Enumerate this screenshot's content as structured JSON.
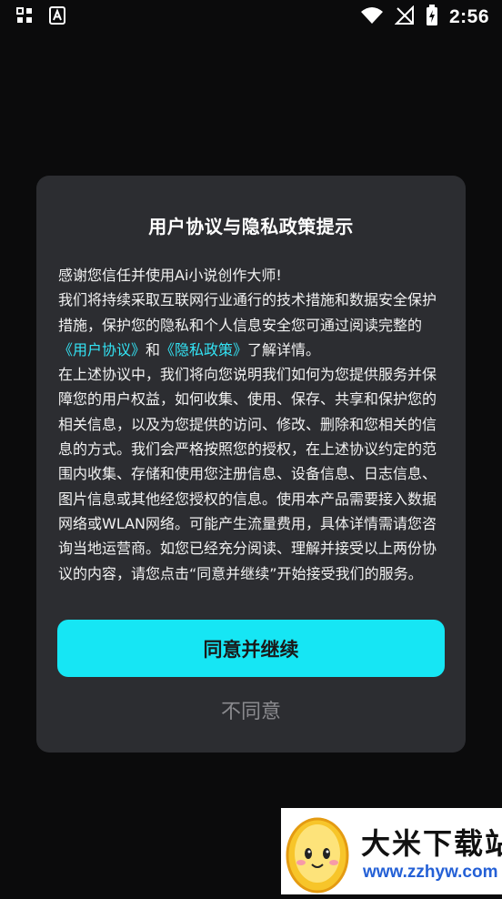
{
  "status_bar": {
    "time": "2:56"
  },
  "dialog": {
    "title": "用户协议与隐私政策提示",
    "intro": "感谢您信任并使用Ai小说创作大师!",
    "para1_start": "我们将持续采取互联网行业通行的技术措施和数据安全保护措施，保护您的隐私和个人信息安全您可通过阅读完整的",
    "user_agreement_link": "《用户协议》",
    "and_text": "和",
    "privacy_policy_link": "《隐私政策》",
    "para1_end": "了解详情。",
    "para2": "在上述协议中，我们将向您说明我们如何为您提供服务并保障您的用户权益，如何收集、使用、保存、共享和保护您的相关信息，以及为您提供的访问、修改、删除和您相关的信息的方式。我们会严格按照您的授权，在上述协议约定的范围内收集、存储和使用您注册信息、设备信息、日志信息、图片信息或其他经您授权的信息。使用本产品需要接入数据网络或WLAN网络。可能产生流量费用，具体详情需请您咨询当地运营商。如您已经充分阅读、理解并接受以上两份协议的内容，请您点击“同意并继续”开始接受我们的服务。",
    "agree_label": "同意并继续",
    "disagree_label": "不同意"
  },
  "watermark": {
    "name": "大米下载站",
    "url": "www.zzhyw.com"
  },
  "colors": {
    "accent": "#16e6f4",
    "link": "#33e4f5",
    "dialog_bg": "#2c2d31",
    "background": "#0b0b0c"
  }
}
